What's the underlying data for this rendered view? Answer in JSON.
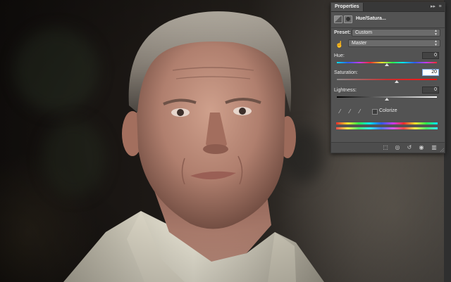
{
  "panel": {
    "tab_label": "Properties",
    "collapse_glyph": "▸▸",
    "menu_glyph": "≡",
    "adjustment_title": "Hue/Satura...",
    "adjustment_icon": "hue-saturation-adjustment-icon",
    "mask_icon": "layer-mask-icon"
  },
  "controls": {
    "preset_label": "Preset:",
    "preset_value": "Custom",
    "channel_value": "Master",
    "hue_label": "Hue:",
    "hue_value": "0",
    "hue_level": 0,
    "saturation_label": "Saturation:",
    "saturation_value": "20",
    "saturation_level": 20,
    "lightness_label": "Lightness:",
    "lightness_value": "0",
    "lightness_level": 0,
    "colorize_label": "Colorize",
    "colorize_checked": false
  },
  "icons": {
    "targeted_adjustment": "hand-icon",
    "eyedropper": "eyedropper-icon",
    "eyedropper_add": "eyedropper-plus-icon",
    "eyedropper_subtract": "eyedropper-minus-icon",
    "footer": [
      "clip-to-layer-icon",
      "view-previous-state-icon",
      "reset-icon",
      "visibility-eye-icon",
      "trash-icon"
    ]
  },
  "colors": {
    "panel_bg": "#535353",
    "tab_bar_bg": "#383838",
    "active_input_bg": "#ffffff"
  }
}
